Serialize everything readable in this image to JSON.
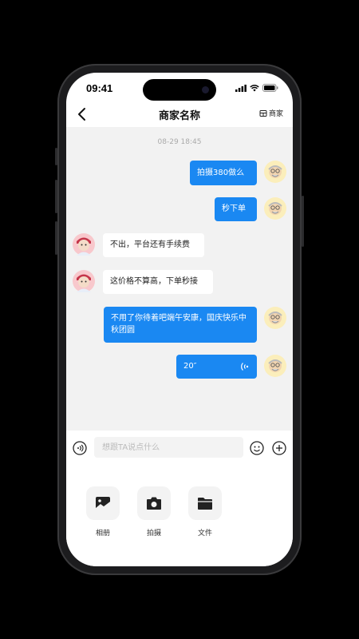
{
  "status_bar": {
    "time": "09:41"
  },
  "nav": {
    "title": "商家名称",
    "shop_label": "商家"
  },
  "chat": {
    "timestamp": "08-29  18:45",
    "messages": [
      {
        "from": "me",
        "text": "拍摄380做么"
      },
      {
        "from": "me",
        "text": "秒下单"
      },
      {
        "from": "other",
        "text": "不出，平台还有手续费"
      },
      {
        "from": "other",
        "text": "这价格不算高，下单秒接"
      },
      {
        "from": "me",
        "text": "不用了你待着吧端午安康，国庆快乐中秋团圆"
      },
      {
        "from": "me",
        "type": "voice",
        "text": "20″"
      }
    ]
  },
  "composer": {
    "placeholder": "想跟TA说点什么"
  },
  "tools": [
    {
      "label": "相册",
      "icon": "photo-album-icon"
    },
    {
      "label": "拍摄",
      "icon": "camera-icon"
    },
    {
      "label": "文件",
      "icon": "folder-icon"
    }
  ],
  "colors": {
    "accent": "#1a88f2",
    "chat_bg": "#f2f2f2",
    "bubble_other": "#ffffff"
  }
}
